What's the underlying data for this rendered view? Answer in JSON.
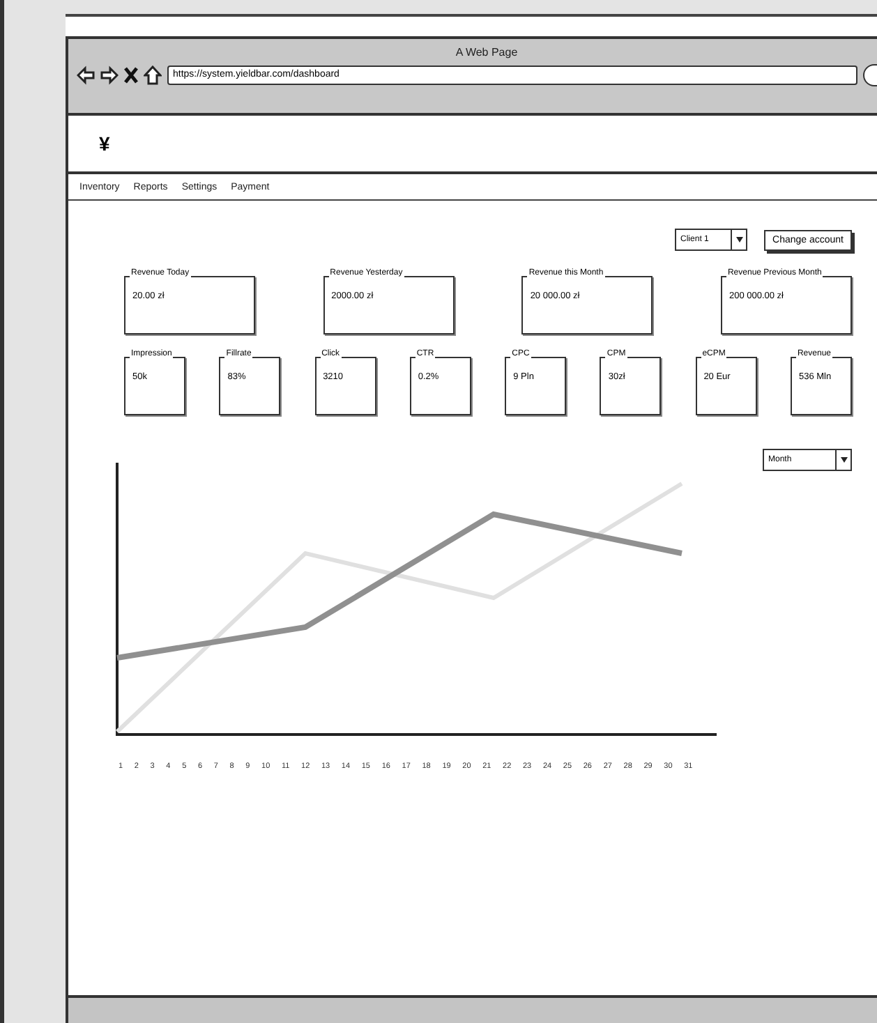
{
  "browser": {
    "title": "A Web Page",
    "url": "https://system.yieldbar.com/dashboard"
  },
  "logo": "¥",
  "nav": [
    "Inventory",
    "Reports",
    "Settings",
    "Payment"
  ],
  "account": {
    "client": "Client 1",
    "button": "Change account"
  },
  "revenue_cards": [
    {
      "label": "Revenue Today",
      "value": "20.00 zł"
    },
    {
      "label": "Revenue Yesterday",
      "value": "2000.00 zł"
    },
    {
      "label": "Revenue this Month",
      "value": "20 000.00 zł"
    },
    {
      "label": "Revenue Previous Month",
      "value": "200 000.00 zł"
    }
  ],
  "metrics": [
    {
      "label": "Impression",
      "value": "50k"
    },
    {
      "label": "Fillrate",
      "value": "83%"
    },
    {
      "label": "Click",
      "value": "3210"
    },
    {
      "label": "CTR",
      "value": "0.2%"
    },
    {
      "label": "CPC",
      "value": "9 Pln"
    },
    {
      "label": "CPM",
      "value": "30zł"
    },
    {
      "label": "eCPM",
      "value": "20 Eur"
    },
    {
      "label": "Revenue",
      "value": "536 Mln"
    }
  ],
  "period": "Month",
  "chart": {
    "x_labels": [
      "1",
      "2",
      "3",
      "4",
      "5",
      "6",
      "7",
      "8",
      "9",
      "10",
      "11",
      "12",
      "13",
      "14",
      "15",
      "16",
      "17",
      "18",
      "19",
      "20",
      "21",
      "22",
      "23",
      "24",
      "25",
      "26",
      "27",
      "28",
      "29",
      "30",
      "31"
    ]
  }
}
